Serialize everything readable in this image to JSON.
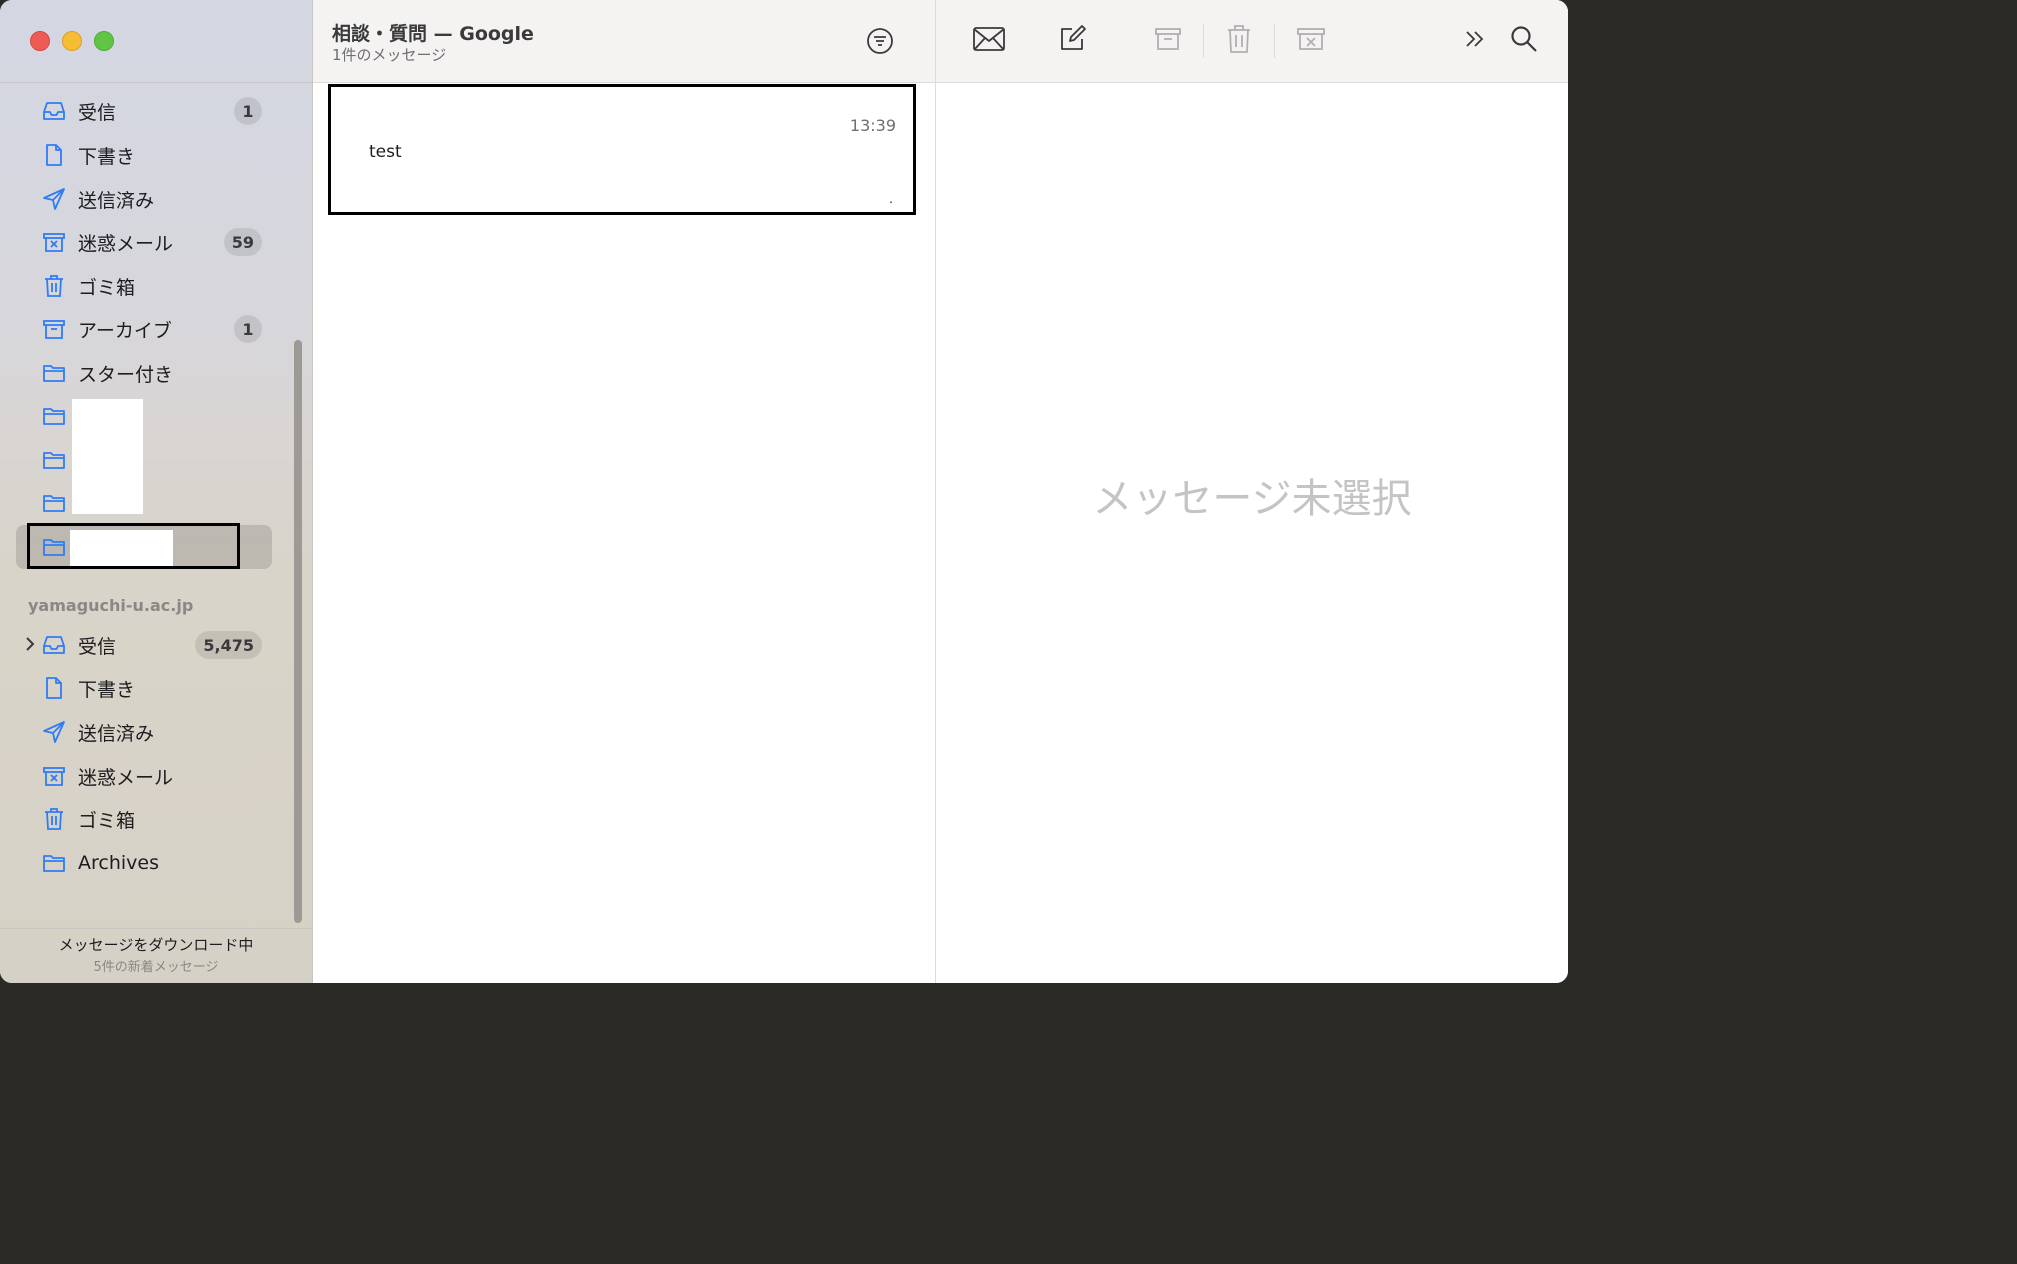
{
  "sidebar": {
    "mailboxes_primary": [
      {
        "icon": "inbox-icon",
        "label": "受信",
        "badge": "1"
      },
      {
        "icon": "draft-icon",
        "label": "下書き",
        "badge": ""
      },
      {
        "icon": "sent-icon",
        "label": "送信済み",
        "badge": ""
      },
      {
        "icon": "junk-icon",
        "label": "迷惑メール",
        "badge": "59"
      },
      {
        "icon": "trash-icon",
        "label": "ゴミ箱",
        "badge": ""
      },
      {
        "icon": "archive-icon",
        "label": "アーカイブ",
        "badge": "1"
      },
      {
        "icon": "folder-icon",
        "label": "スター付き",
        "badge": ""
      }
    ],
    "account_header": "yamaguchi-u.ac.jp",
    "mailboxes_secondary": [
      {
        "icon": "inbox-icon",
        "label": "受信",
        "badge": "5,475"
      },
      {
        "icon": "draft-icon",
        "label": "下書き",
        "badge": ""
      },
      {
        "icon": "sent-icon",
        "label": "送信済み",
        "badge": ""
      },
      {
        "icon": "junk-icon",
        "label": "迷惑メール",
        "badge": ""
      },
      {
        "icon": "trash-icon",
        "label": "ゴミ箱",
        "badge": ""
      },
      {
        "icon": "folder-icon",
        "label": "Archives",
        "badge": ""
      }
    ],
    "status": {
      "main": "メッセージをダウンロード中",
      "sub": "5件の新着メッセージ"
    }
  },
  "message_list": {
    "title": "相談・質問 — Google",
    "subtitle": "1件のメッセージ",
    "messages": [
      {
        "time": "13:39",
        "subject": "test",
        "marker": "."
      }
    ]
  },
  "reader": {
    "empty_text": "メッセージ未選択"
  },
  "colors": {
    "accent": "#2f7cf6",
    "close": "#ee5b55",
    "minimize": "#f5bd32",
    "maximize": "#60c546"
  }
}
